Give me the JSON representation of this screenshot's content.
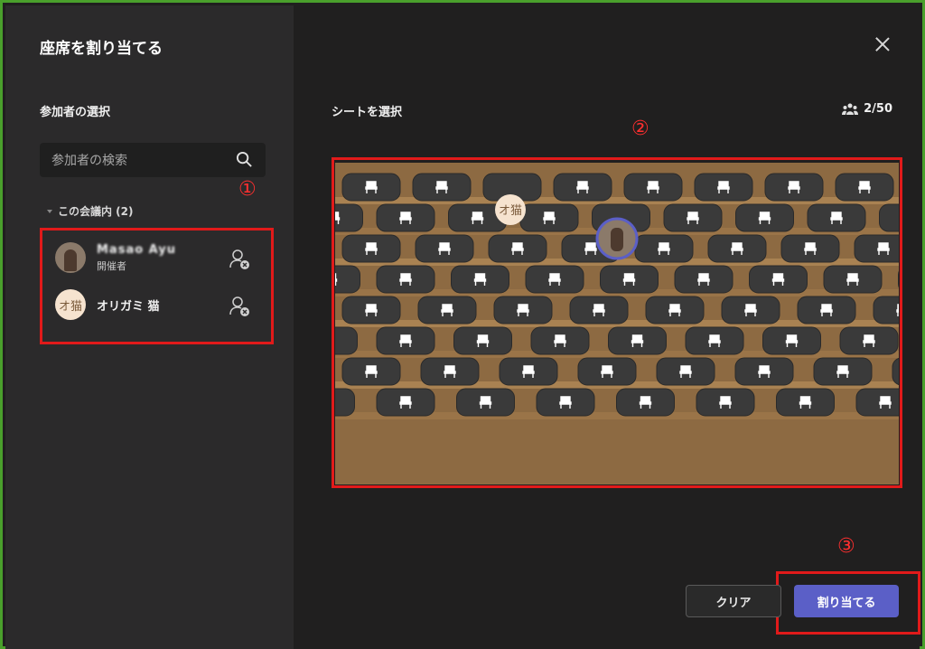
{
  "dialog": {
    "title": "座席を割り当てる",
    "close_label": "Close"
  },
  "left": {
    "section_title": "参加者の選択",
    "search_placeholder": "参加者の検索",
    "group_label": "この会議内 (2)",
    "participants": [
      {
        "name": "Masao Ayu",
        "role": "開催者",
        "avatar": "photo"
      },
      {
        "name": "オリガミ 猫",
        "role": "",
        "avatar": "オ猫"
      }
    ]
  },
  "right": {
    "section_title": "シートを選択",
    "count": "2/50"
  },
  "annotations": {
    "one": "①",
    "two": "②",
    "three": "③"
  },
  "theater": {
    "assigned_initials": "オ猫",
    "rows": 8,
    "seats_per_row": 9
  },
  "buttons": {
    "clear": "クリア",
    "assign": "割り当てる"
  },
  "colors": {
    "accent": "#5b5fc7",
    "highlight": "#e11a1a",
    "frame": "#4aa02c"
  }
}
